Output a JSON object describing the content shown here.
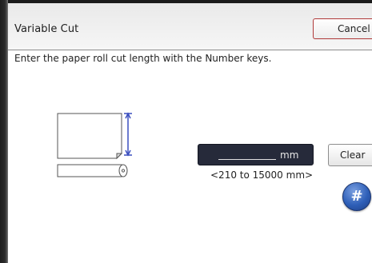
{
  "title": "Variable Cut",
  "buttons": {
    "cancel": "Cancel",
    "clear": "Clear",
    "hash": "#"
  },
  "instruction": "Enter the paper roll cut length with the Number keys.",
  "input": {
    "value": "",
    "unit": "mm",
    "range": "<210 to 15000 mm>"
  },
  "icons": {
    "illustration": "paper-roll-cut-icon",
    "hash": "hash-icon"
  },
  "colors": {
    "display_bg": "#262a3a",
    "hash_blue": "#2e5fb8",
    "cancel_border": "#b03a3a",
    "dimension_arrow": "#3b4fbf"
  }
}
